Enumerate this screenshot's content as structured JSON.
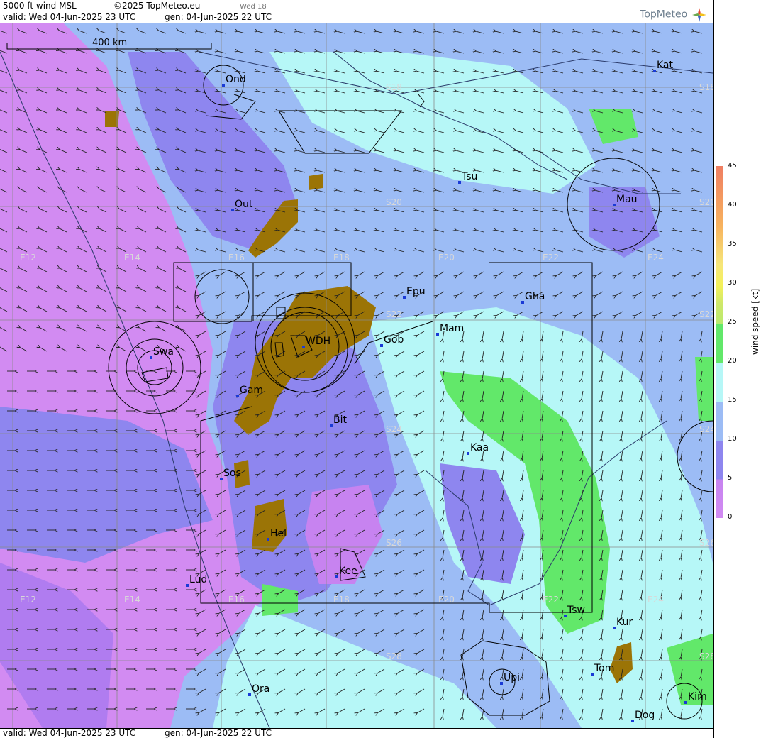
{
  "header": {
    "title": "5000 ft wind MSL",
    "copyright": "©2025 TopMeteo.eu",
    "day_tag": "Wed 18",
    "valid": "valid:  Wed  04-Jun-2025  23 UTC",
    "generated": "gen: 04-Jun-2025 22 UTC",
    "logo": "TopMeteo"
  },
  "footer": {
    "valid": "valid:  Wed  04-Jun-2025  23 UTC",
    "generated": "gen: 04-Jun-2025 22 UTC"
  },
  "scale_bar": {
    "label": "400 km"
  },
  "colorbar": {
    "label": "wind speed [kt]",
    "ticks": [
      "45",
      "40",
      "35",
      "30",
      "25",
      "20",
      "15",
      "10",
      "5",
      "0"
    ]
  },
  "grid_labels": {
    "longitudes_top": [
      "E12",
      "E14",
      "E16",
      "E18",
      "E20",
      "E22",
      "E24"
    ],
    "longitudes_bottom": [
      "E12",
      "E14",
      "E16",
      "E18",
      "E20",
      "E22",
      "E24"
    ],
    "latitudes": [
      "S18",
      "S20",
      "S22",
      "S24",
      "S26",
      "S28"
    ],
    "latitudes_right": [
      "S18",
      "S20",
      "S22",
      "S24",
      "S26",
      "S28"
    ]
  },
  "stations": [
    {
      "code": "Ond"
    },
    {
      "code": "Kat"
    },
    {
      "code": "Tsu"
    },
    {
      "code": "Mau"
    },
    {
      "code": "Out"
    },
    {
      "code": "Epu"
    },
    {
      "code": "Gha"
    },
    {
      "code": "Mam"
    },
    {
      "code": "WDH"
    },
    {
      "code": "Gob"
    },
    {
      "code": "Swa"
    },
    {
      "code": "Gam"
    },
    {
      "code": "Bit"
    },
    {
      "code": "Kaa"
    },
    {
      "code": "Sos"
    },
    {
      "code": "Hel"
    },
    {
      "code": "Kee"
    },
    {
      "code": "Lud"
    },
    {
      "code": "Tsw"
    },
    {
      "code": "Kur"
    },
    {
      "code": "Tom"
    },
    {
      "code": "Ora"
    },
    {
      "code": "Upi"
    },
    {
      "code": "Kim"
    },
    {
      "code": "Dog"
    }
  ],
  "colors": {
    "calm": "#d28bf2",
    "light": "#8e86ef",
    "moderate": "#9cbcf5",
    "fresh": "#b6f7f7",
    "strong": "#62e86a",
    "terrain": "#9b7406"
  }
}
